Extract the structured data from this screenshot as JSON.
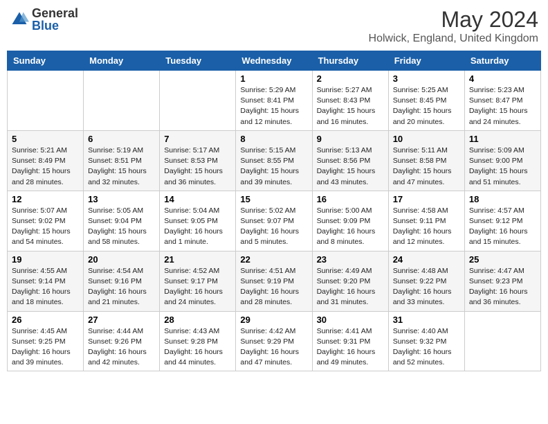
{
  "header": {
    "logo_general": "General",
    "logo_blue": "Blue",
    "month_year": "May 2024",
    "location": "Holwick, England, United Kingdom"
  },
  "days_of_week": [
    "Sunday",
    "Monday",
    "Tuesday",
    "Wednesday",
    "Thursday",
    "Friday",
    "Saturday"
  ],
  "weeks": [
    [
      {
        "day": "",
        "info": ""
      },
      {
        "day": "",
        "info": ""
      },
      {
        "day": "",
        "info": ""
      },
      {
        "day": "1",
        "info": "Sunrise: 5:29 AM\nSunset: 8:41 PM\nDaylight: 15 hours\nand 12 minutes."
      },
      {
        "day": "2",
        "info": "Sunrise: 5:27 AM\nSunset: 8:43 PM\nDaylight: 15 hours\nand 16 minutes."
      },
      {
        "day": "3",
        "info": "Sunrise: 5:25 AM\nSunset: 8:45 PM\nDaylight: 15 hours\nand 20 minutes."
      },
      {
        "day": "4",
        "info": "Sunrise: 5:23 AM\nSunset: 8:47 PM\nDaylight: 15 hours\nand 24 minutes."
      }
    ],
    [
      {
        "day": "5",
        "info": "Sunrise: 5:21 AM\nSunset: 8:49 PM\nDaylight: 15 hours\nand 28 minutes."
      },
      {
        "day": "6",
        "info": "Sunrise: 5:19 AM\nSunset: 8:51 PM\nDaylight: 15 hours\nand 32 minutes."
      },
      {
        "day": "7",
        "info": "Sunrise: 5:17 AM\nSunset: 8:53 PM\nDaylight: 15 hours\nand 36 minutes."
      },
      {
        "day": "8",
        "info": "Sunrise: 5:15 AM\nSunset: 8:55 PM\nDaylight: 15 hours\nand 39 minutes."
      },
      {
        "day": "9",
        "info": "Sunrise: 5:13 AM\nSunset: 8:56 PM\nDaylight: 15 hours\nand 43 minutes."
      },
      {
        "day": "10",
        "info": "Sunrise: 5:11 AM\nSunset: 8:58 PM\nDaylight: 15 hours\nand 47 minutes."
      },
      {
        "day": "11",
        "info": "Sunrise: 5:09 AM\nSunset: 9:00 PM\nDaylight: 15 hours\nand 51 minutes."
      }
    ],
    [
      {
        "day": "12",
        "info": "Sunrise: 5:07 AM\nSunset: 9:02 PM\nDaylight: 15 hours\nand 54 minutes."
      },
      {
        "day": "13",
        "info": "Sunrise: 5:05 AM\nSunset: 9:04 PM\nDaylight: 15 hours\nand 58 minutes."
      },
      {
        "day": "14",
        "info": "Sunrise: 5:04 AM\nSunset: 9:05 PM\nDaylight: 16 hours\nand 1 minute."
      },
      {
        "day": "15",
        "info": "Sunrise: 5:02 AM\nSunset: 9:07 PM\nDaylight: 16 hours\nand 5 minutes."
      },
      {
        "day": "16",
        "info": "Sunrise: 5:00 AM\nSunset: 9:09 PM\nDaylight: 16 hours\nand 8 minutes."
      },
      {
        "day": "17",
        "info": "Sunrise: 4:58 AM\nSunset: 9:11 PM\nDaylight: 16 hours\nand 12 minutes."
      },
      {
        "day": "18",
        "info": "Sunrise: 4:57 AM\nSunset: 9:12 PM\nDaylight: 16 hours\nand 15 minutes."
      }
    ],
    [
      {
        "day": "19",
        "info": "Sunrise: 4:55 AM\nSunset: 9:14 PM\nDaylight: 16 hours\nand 18 minutes."
      },
      {
        "day": "20",
        "info": "Sunrise: 4:54 AM\nSunset: 9:16 PM\nDaylight: 16 hours\nand 21 minutes."
      },
      {
        "day": "21",
        "info": "Sunrise: 4:52 AM\nSunset: 9:17 PM\nDaylight: 16 hours\nand 24 minutes."
      },
      {
        "day": "22",
        "info": "Sunrise: 4:51 AM\nSunset: 9:19 PM\nDaylight: 16 hours\nand 28 minutes."
      },
      {
        "day": "23",
        "info": "Sunrise: 4:49 AM\nSunset: 9:20 PM\nDaylight: 16 hours\nand 31 minutes."
      },
      {
        "day": "24",
        "info": "Sunrise: 4:48 AM\nSunset: 9:22 PM\nDaylight: 16 hours\nand 33 minutes."
      },
      {
        "day": "25",
        "info": "Sunrise: 4:47 AM\nSunset: 9:23 PM\nDaylight: 16 hours\nand 36 minutes."
      }
    ],
    [
      {
        "day": "26",
        "info": "Sunrise: 4:45 AM\nSunset: 9:25 PM\nDaylight: 16 hours\nand 39 minutes."
      },
      {
        "day": "27",
        "info": "Sunrise: 4:44 AM\nSunset: 9:26 PM\nDaylight: 16 hours\nand 42 minutes."
      },
      {
        "day": "28",
        "info": "Sunrise: 4:43 AM\nSunset: 9:28 PM\nDaylight: 16 hours\nand 44 minutes."
      },
      {
        "day": "29",
        "info": "Sunrise: 4:42 AM\nSunset: 9:29 PM\nDaylight: 16 hours\nand 47 minutes."
      },
      {
        "day": "30",
        "info": "Sunrise: 4:41 AM\nSunset: 9:31 PM\nDaylight: 16 hours\nand 49 minutes."
      },
      {
        "day": "31",
        "info": "Sunrise: 4:40 AM\nSunset: 9:32 PM\nDaylight: 16 hours\nand 52 minutes."
      },
      {
        "day": "",
        "info": ""
      }
    ]
  ]
}
